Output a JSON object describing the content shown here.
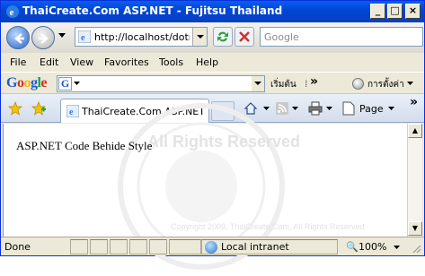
{
  "window": {
    "title": "ThaiCreate.Com ASP.NET - Fujitsu Thailand",
    "minimize_glyph": "_",
    "maximize_glyph": "□",
    "close_glyph": "×"
  },
  "nav": {
    "address_url": "http://localhost/dotne",
    "search_placeholder": "Google",
    "icons": [
      "back-arrow-icon",
      "forward-arrow-icon",
      "refresh-icon",
      "stop-icon",
      "ie-page-icon"
    ]
  },
  "menu": {
    "items": [
      "File",
      "Edit",
      "View",
      "Favorites",
      "Tools",
      "Help"
    ]
  },
  "google_toolbar": {
    "logo": "Google",
    "search_btn": "เริ่มต้น",
    "chevron": "»",
    "settings": "การตั้งค่า"
  },
  "tabs": {
    "active_tab_label": "ThaiCreate.Com ASP.NET",
    "page_menu": "Page",
    "overflow": "»"
  },
  "content": {
    "heading": "ASP.NET Code Behide Style",
    "watermark_top": "All Rights Reserved",
    "watermark_bottom": "Copyright 2009, ThaiCreate.Com, All Rights Reserved"
  },
  "status": {
    "text": "Done",
    "zone": "Local intranet",
    "zoom": "100%"
  },
  "colors": {
    "titlebar": "#0046d5",
    "chrome": "#ece9d8",
    "google_blue": "#1a5bd7",
    "google_red": "#d62d20",
    "google_yellow": "#f2b50f",
    "google_green": "#159e4a"
  }
}
